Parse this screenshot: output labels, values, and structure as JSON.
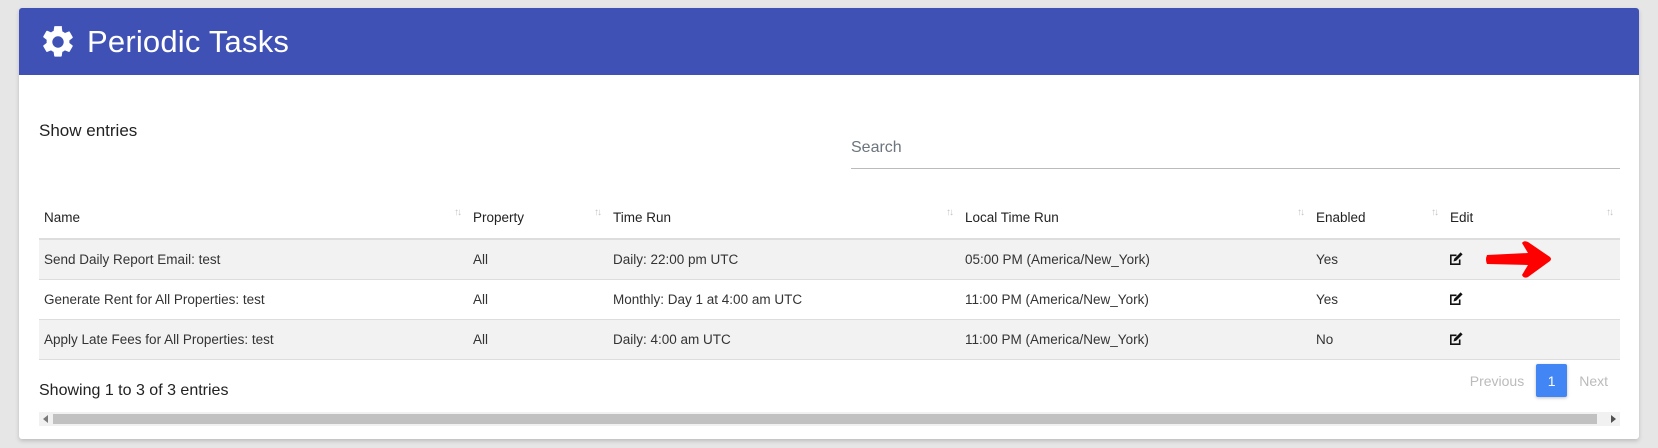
{
  "header": {
    "title": "Periodic Tasks",
    "icon": "gear-icon",
    "color": "#3f51b5"
  },
  "controls": {
    "show_entries": "Show entries",
    "search_placeholder": "Search"
  },
  "table": {
    "columns": [
      "Name",
      "Property",
      "Time Run",
      "Local Time Run",
      "Enabled",
      "Edit"
    ],
    "rows": [
      {
        "name": "Send Daily Report Email: test",
        "property": "All",
        "time_run": "Daily: 22:00 pm UTC",
        "local_time_run": "05:00 PM (America/New_York)",
        "enabled": "Yes",
        "edit": "edit-icon"
      },
      {
        "name": "Generate Rent for All Properties: test",
        "property": "All",
        "time_run": "Monthly: Day 1 at 4:00 am UTC",
        "local_time_run": "11:00 PM (America/New_York)",
        "enabled": "Yes",
        "edit": "edit-icon"
      },
      {
        "name": "Apply Late Fees for All Properties: test",
        "property": "All",
        "time_run": "Daily: 4:00 am UTC",
        "local_time_run": "11:00 PM (America/New_York)",
        "enabled": "No",
        "edit": "edit-icon"
      }
    ]
  },
  "footer": {
    "info": "Showing 1 to 3 of 3 entries",
    "previous": "Previous",
    "page": "1",
    "next": "Next",
    "active_color": "#4285f4"
  },
  "annotation": {
    "icon": "red-arrow-icon",
    "color": "#ff0000"
  }
}
